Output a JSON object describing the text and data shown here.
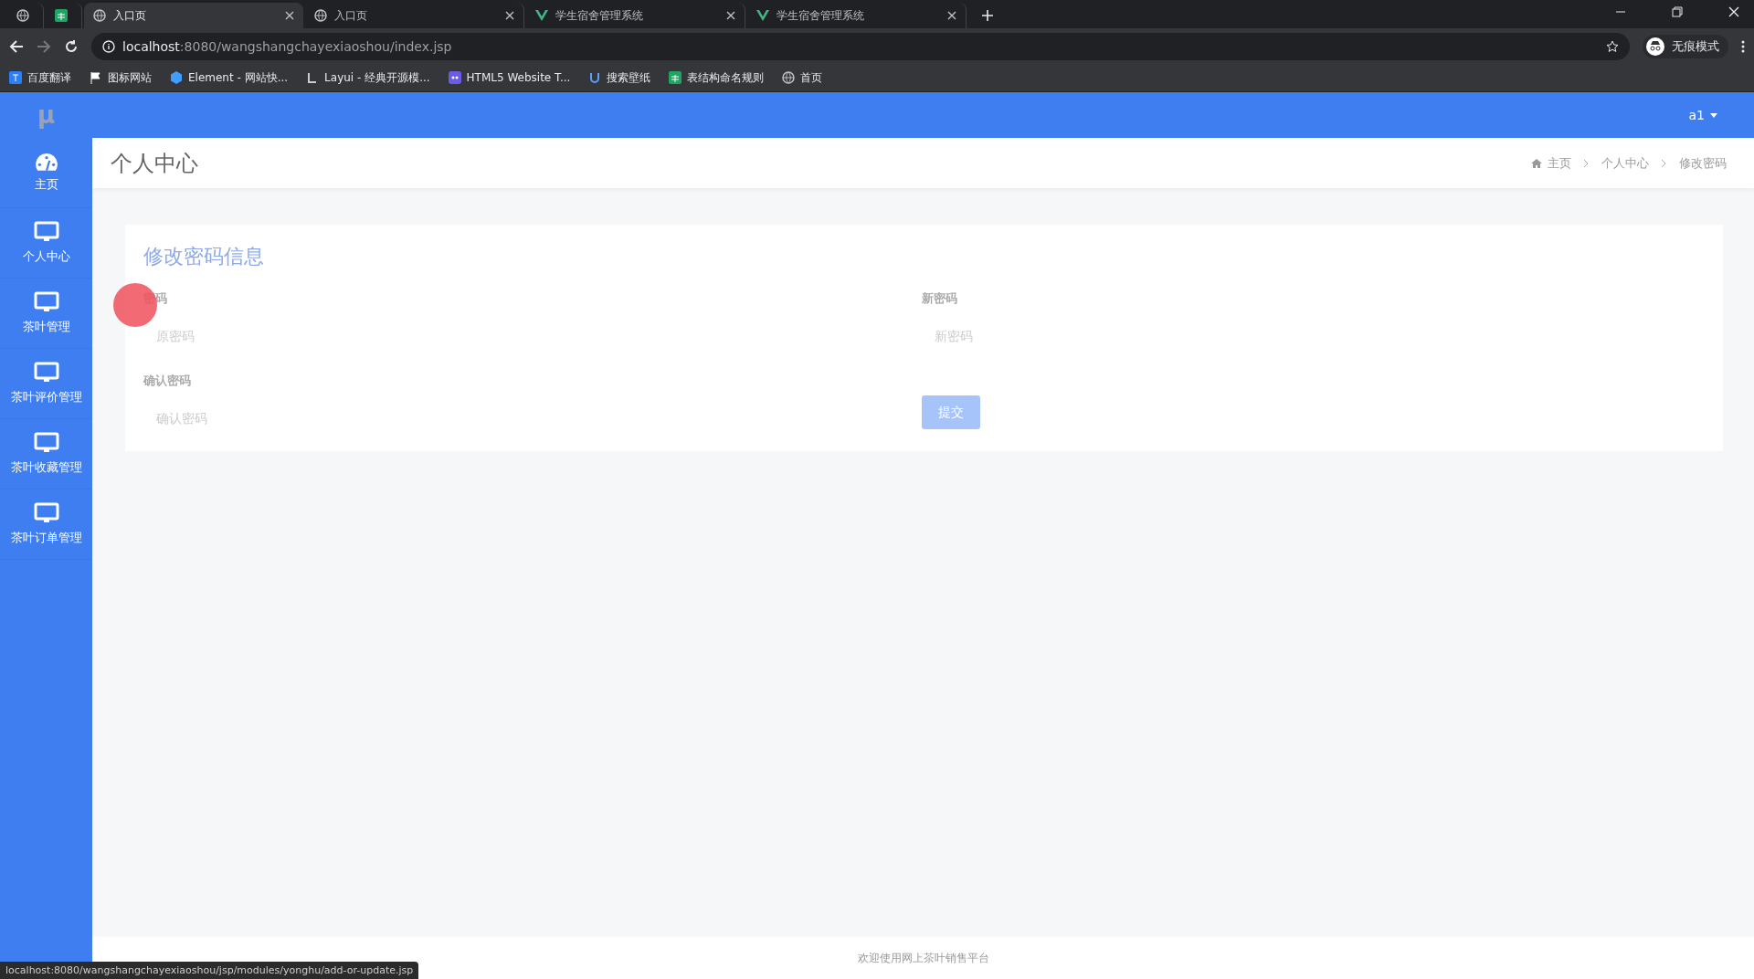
{
  "browser": {
    "tabs": [
      {
        "kind": "globe",
        "selected": false
      },
      {
        "kind": "sheet",
        "selected": false
      },
      {
        "kind": "globe",
        "title": "入口页",
        "selected": true
      },
      {
        "kind": "globe",
        "title": "入口页",
        "selected": false
      },
      {
        "kind": "vue",
        "title": "学生宿舍管理系统",
        "selected": false
      },
      {
        "kind": "vue",
        "title": "学生宿舍管理系统",
        "selected": false
      }
    ],
    "address": {
      "host": "localhost",
      "path": ":8080/wangshangchayexiaoshou/index.jsp"
    },
    "profile": "无痕模式",
    "bookmarks": [
      {
        "kind": "translate",
        "label": "百度翻译"
      },
      {
        "kind": "flag",
        "label": "图标网站"
      },
      {
        "kind": "hexagon",
        "label": "Element - 网站快..."
      },
      {
        "kind": "layui",
        "label": "Layui - 经典开源模..."
      },
      {
        "kind": "html5",
        "label": "HTML5 Website T..."
      },
      {
        "kind": "u",
        "label": "搜索壁纸"
      },
      {
        "kind": "sheet",
        "label": "表结构命名规则"
      },
      {
        "kind": "globe",
        "label": "首页"
      }
    ],
    "status_url": "localhost:8080/wangshangchayexiaoshou/jsp/modules/yonghu/add-or-update.jsp"
  },
  "app": {
    "logo": "μ",
    "user": "a1",
    "sidebar": [
      {
        "kind": "dashboard",
        "label": "主页"
      },
      {
        "kind": "monitor",
        "label": "个人中心"
      },
      {
        "kind": "monitor",
        "label": "茶叶管理"
      },
      {
        "kind": "monitor",
        "label": "茶叶评价管理"
      },
      {
        "kind": "monitor",
        "label": "茶叶收藏管理"
      },
      {
        "kind": "monitor",
        "label": "茶叶订单管理"
      }
    ],
    "page_title": "个人中心",
    "breadcrumb": [
      "主页",
      "个人中心",
      "修改密码"
    ],
    "form": {
      "title": "修改密码信息",
      "fields": [
        {
          "label": "密码",
          "placeholder": "原密码"
        },
        {
          "label": "新密码",
          "placeholder": "新密码"
        },
        {
          "label": "确认密码",
          "placeholder": "确认密码"
        }
      ],
      "submit": "提交"
    },
    "footer": "欢迎使用网上茶叶销售平台"
  }
}
